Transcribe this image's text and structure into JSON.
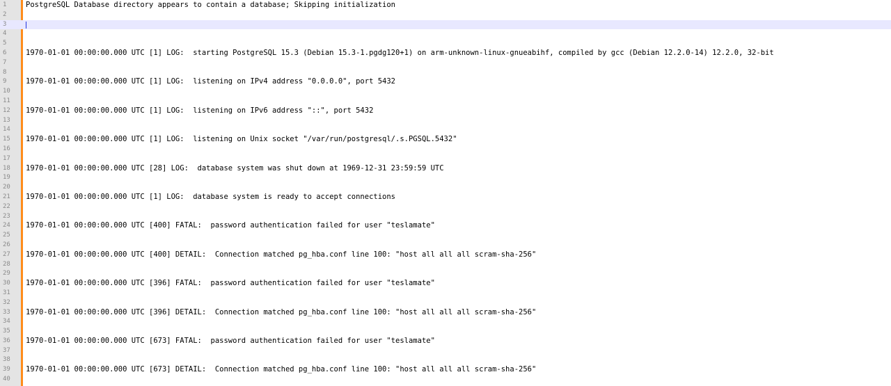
{
  "editor": {
    "lines": [
      {
        "num": "1",
        "text": "PostgreSQL Database directory appears to contain a database; Skipping initialization"
      },
      {
        "num": "2",
        "text": ""
      },
      {
        "num": "3",
        "text": ""
      },
      {
        "num": "4",
        "text": ""
      },
      {
        "num": "5",
        "text": ""
      },
      {
        "num": "6",
        "text": "1970-01-01 00:00:00.000 UTC [1] LOG:  starting PostgreSQL 15.3 (Debian 15.3-1.pgdg120+1) on arm-unknown-linux-gnueabihf, compiled by gcc (Debian 12.2.0-14) 12.2.0, 32-bit"
      },
      {
        "num": "7",
        "text": ""
      },
      {
        "num": "8",
        "text": ""
      },
      {
        "num": "9",
        "text": "1970-01-01 00:00:00.000 UTC [1] LOG:  listening on IPv4 address \"0.0.0.0\", port 5432"
      },
      {
        "num": "10",
        "text": ""
      },
      {
        "num": "11",
        "text": ""
      },
      {
        "num": "12",
        "text": "1970-01-01 00:00:00.000 UTC [1] LOG:  listening on IPv6 address \"::\", port 5432"
      },
      {
        "num": "13",
        "text": ""
      },
      {
        "num": "14",
        "text": ""
      },
      {
        "num": "15",
        "text": "1970-01-01 00:00:00.000 UTC [1] LOG:  listening on Unix socket \"/var/run/postgresql/.s.PGSQL.5432\""
      },
      {
        "num": "16",
        "text": ""
      },
      {
        "num": "17",
        "text": ""
      },
      {
        "num": "18",
        "text": "1970-01-01 00:00:00.000 UTC [28] LOG:  database system was shut down at 1969-12-31 23:59:59 UTC"
      },
      {
        "num": "19",
        "text": ""
      },
      {
        "num": "20",
        "text": ""
      },
      {
        "num": "21",
        "text": "1970-01-01 00:00:00.000 UTC [1] LOG:  database system is ready to accept connections"
      },
      {
        "num": "22",
        "text": ""
      },
      {
        "num": "23",
        "text": ""
      },
      {
        "num": "24",
        "text": "1970-01-01 00:00:00.000 UTC [400] FATAL:  password authentication failed for user \"teslamate\""
      },
      {
        "num": "25",
        "text": ""
      },
      {
        "num": "26",
        "text": ""
      },
      {
        "num": "27",
        "text": "1970-01-01 00:00:00.000 UTC [400] DETAIL:  Connection matched pg_hba.conf line 100: \"host all all all scram-sha-256\""
      },
      {
        "num": "28",
        "text": ""
      },
      {
        "num": "29",
        "text": ""
      },
      {
        "num": "30",
        "text": "1970-01-01 00:00:00.000 UTC [396] FATAL:  password authentication failed for user \"teslamate\""
      },
      {
        "num": "31",
        "text": ""
      },
      {
        "num": "32",
        "text": ""
      },
      {
        "num": "33",
        "text": "1970-01-01 00:00:00.000 UTC [396] DETAIL:  Connection matched pg_hba.conf line 100: \"host all all all scram-sha-256\""
      },
      {
        "num": "34",
        "text": ""
      },
      {
        "num": "35",
        "text": ""
      },
      {
        "num": "36",
        "text": "1970-01-01 00:00:00.000 UTC [673] FATAL:  password authentication failed for user \"teslamate\""
      },
      {
        "num": "37",
        "text": ""
      },
      {
        "num": "38",
        "text": ""
      },
      {
        "num": "39",
        "text": "1970-01-01 00:00:00.000 UTC [673] DETAIL:  Connection matched pg_hba.conf line 100: \"host all all all scram-sha-256\""
      },
      {
        "num": "40",
        "text": ""
      }
    ],
    "current_line": "3"
  },
  "colors": {
    "gutter": "#e4e4e4",
    "change_margin": "#ff8c1a",
    "current_line_highlight": "#e8e8ff",
    "caret": "#2233dd"
  }
}
